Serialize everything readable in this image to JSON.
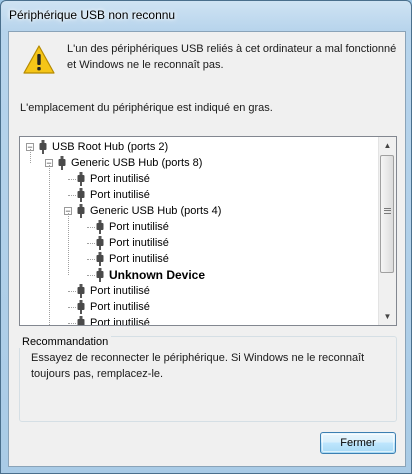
{
  "window": {
    "title": "Périphérique USB non reconnu"
  },
  "message": {
    "icon": "warning-icon",
    "line1": "L'un des périphériques USB reliés à cet ordinateur a mal fonctionné",
    "line2": "et Windows ne le reconnaît pas."
  },
  "location_label": "L'emplacement du périphérique est indiqué en gras.",
  "tree": {
    "nodes": [
      {
        "label": "USB Root Hub (ports 2)",
        "level": 0,
        "expander": true
      },
      {
        "label": "Generic USB Hub (ports 8)",
        "level": 1,
        "expander": true
      },
      {
        "label": "Port inutilisé",
        "level": 2,
        "expander": false
      },
      {
        "label": "Port inutilisé",
        "level": 2,
        "expander": false
      },
      {
        "label": "Generic USB Hub (ports 4)",
        "level": 2,
        "expander": true
      },
      {
        "label": "Port inutilisé",
        "level": 3,
        "expander": false
      },
      {
        "label": "Port inutilisé",
        "level": 3,
        "expander": false
      },
      {
        "label": "Port inutilisé",
        "level": 3,
        "expander": false
      },
      {
        "label": "Unknown Device",
        "level": 3,
        "expander": false,
        "bold": true
      },
      {
        "label": "Port inutilisé",
        "level": 2,
        "expander": false
      },
      {
        "label": "Port inutilisé",
        "level": 2,
        "expander": false
      },
      {
        "label": "Port inutilisé",
        "level": 2,
        "expander": false
      }
    ],
    "scroll_up_icon": "arrow-up-icon",
    "scroll_down_icon": "arrow-down-icon"
  },
  "recommendation": {
    "title": "Recommandation",
    "line1": "Essayez de reconnecter le périphérique. Si Windows ne le reconnaît",
    "line2": "toujours pas, remplacez-le."
  },
  "buttons": {
    "close_label": "Fermer"
  },
  "colors": {
    "title_bar": "#b7d4ec",
    "warning_yellow": "#f5c518",
    "button_border": "#3c7fb1"
  }
}
